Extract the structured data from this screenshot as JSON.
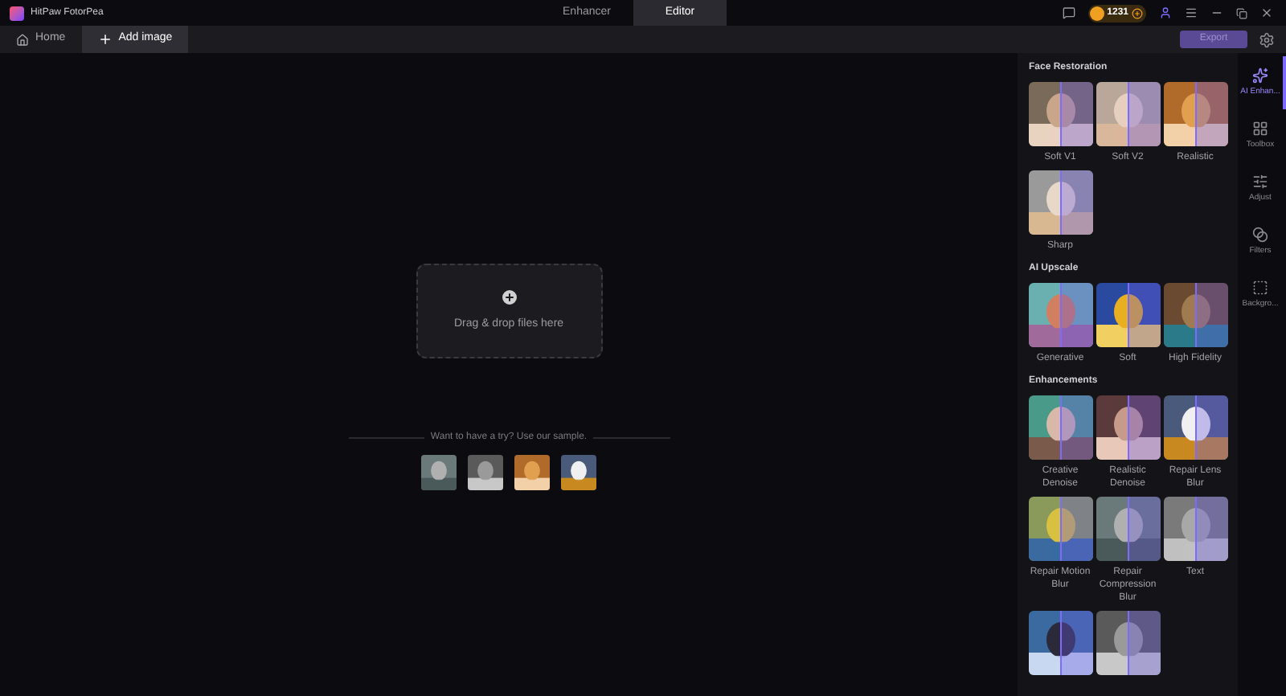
{
  "window": {
    "title": "HitPaw FotorPea"
  },
  "mode_tabs": [
    {
      "label": "Enhancer",
      "selected": false
    },
    {
      "label": "Editor",
      "selected": true
    }
  ],
  "credits": "1231",
  "toolbar": {
    "tabs": [
      {
        "label": "Home",
        "selected": false
      },
      {
        "label": "Add image",
        "selected": true
      }
    ],
    "export": "Export"
  },
  "drop_zone": {
    "text": "Drag & drop files here"
  },
  "samples": {
    "prompt": "Want to have a try? Use our sample."
  },
  "sections": [
    {
      "title": "Face Restoration",
      "items": [
        {
          "label": "Soft V1"
        },
        {
          "label": "Soft V2"
        },
        {
          "label": "Realistic"
        },
        {
          "label": "Sharp"
        }
      ]
    },
    {
      "title": "AI Upscale",
      "items": [
        {
          "label": "Generative"
        },
        {
          "label": "Soft"
        },
        {
          "label": "High Fidelity"
        }
      ]
    },
    {
      "title": "Enhancements",
      "items": [
        {
          "label": "Creative Denoise"
        },
        {
          "label": "Realistic Denoise"
        },
        {
          "label": "Repair Lens Blur"
        },
        {
          "label": "Repair Motion Blur"
        },
        {
          "label": "Repair Compression Blur"
        },
        {
          "label": "Text"
        },
        {
          "kind": "picture"
        },
        {
          "kind": "picture"
        }
      ]
    }
  ],
  "rail": [
    {
      "label": "AI Enhan...",
      "selected": true
    },
    {
      "label": "Toolbox",
      "selected": false
    },
    {
      "label": "Adjust",
      "selected": false
    },
    {
      "label": "Filters",
      "selected": false
    },
    {
      "label": "Backgro...",
      "selected": false
    }
  ]
}
